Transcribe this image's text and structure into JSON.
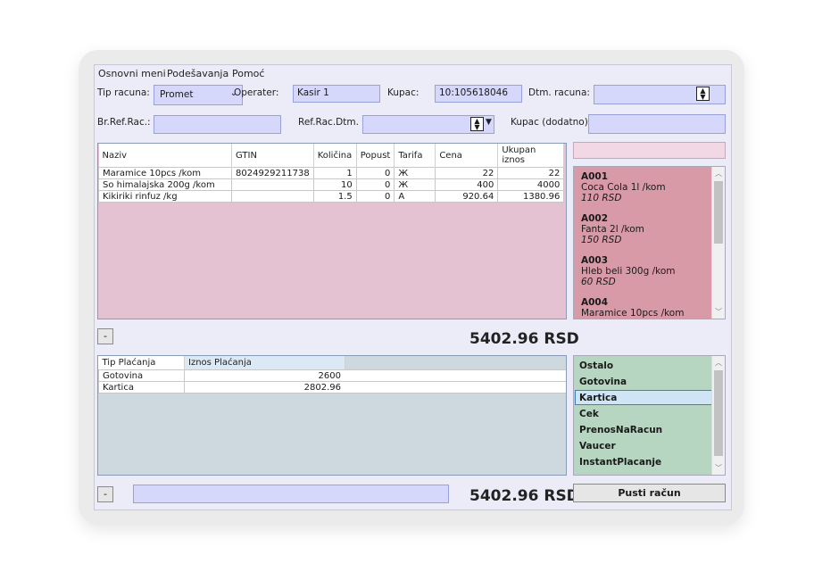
{
  "menu": [
    "Osnovni meni",
    "Podešavanja",
    "Pomoć"
  ],
  "header": {
    "tip_racuna_label": "Tip racuna:",
    "tip_racuna_value": "Promet",
    "operater_label": "Operater:",
    "operater_value": "Kasir 1",
    "kupac_label": "Kupac:",
    "kupac_value": "10:105618046",
    "dtm_racuna_label": "Dtm. racuna:",
    "dtm_racuna_value": "",
    "br_ref_rac_label": "Br.Ref.Rac.:",
    "br_ref_rac_value": "",
    "ref_rac_dtm_label": "Ref.Rac.Dtm.",
    "ref_rac_dtm_value": "",
    "kupac_dodatno_label": "Kupac (dodatno):",
    "kupac_dodatno_value": ""
  },
  "items_table": {
    "columns": [
      "Naziv",
      "GTIN",
      "Količina",
      "Popust",
      "Tarifa",
      "Cena",
      "Ukupan iznos"
    ],
    "rows": [
      [
        "Maramice 10pcs /kom",
        "8024929211738",
        "1",
        "0",
        "Ж",
        "22",
        "22"
      ],
      [
        "So himalajska 200g /kom",
        "",
        "10",
        "0",
        "Ж",
        "400",
        "4000"
      ],
      [
        "Kikiriki rinfuz /kg",
        "",
        "1.5",
        "0",
        "A",
        "920.64",
        "1380.96"
      ]
    ]
  },
  "product_search": {
    "value": ""
  },
  "products": [
    {
      "code": "A001",
      "name": "Coca Cola 1l /kom",
      "price": "110 RSD"
    },
    {
      "code": "A002",
      "name": "Fanta 2l /kom",
      "price": "150 RSD"
    },
    {
      "code": "A003",
      "name": "Hleb beli 300g /kom",
      "price": "60 RSD"
    },
    {
      "code": "A004",
      "name": "Maramice 10pcs /kom",
      "price": ""
    }
  ],
  "remove_item_label": "-",
  "total_top": "5402.96 RSD",
  "payments_table": {
    "columns": [
      "Tip Plaćanja",
      "Iznos Plaćanja"
    ],
    "rows": [
      [
        "Gotovina",
        "2600"
      ],
      [
        "Kartica",
        "2802.96"
      ]
    ]
  },
  "payment_types": [
    "Ostalo",
    "Gotovina",
    "Kartica",
    "Cek",
    "PrenosNaRacun",
    "Vaucer",
    "InstantPlacanje"
  ],
  "selected_payment_type": "Kartica",
  "remove_payment_label": "-",
  "payment_note_value": "",
  "total_bottom": "5402.96 RSD",
  "submit_label": "Pusti račun",
  "colors": {
    "items_bg": "#e4c2d2",
    "products_bg": "#d99aa8",
    "payments_bg": "#cdd9df",
    "payment_types_bg": "#b7d6c2",
    "field_bg": "#d6d8fb"
  }
}
